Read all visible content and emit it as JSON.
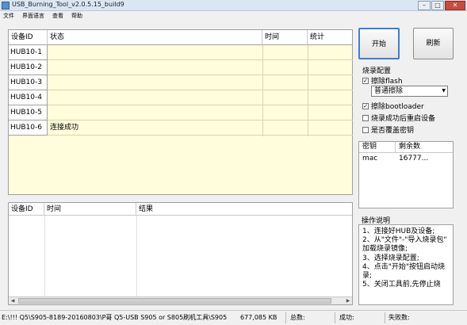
{
  "window": {
    "title": "USB_Burning_Tool_v2.0.5.15_build9",
    "buttons": [
      "–",
      "□",
      "✕"
    ]
  },
  "menu": [
    "文件",
    "界面语言",
    "查看",
    "帮助"
  ],
  "device_grid": {
    "headers": [
      "设备ID",
      "状态",
      "时间",
      "统计"
    ],
    "rows": [
      {
        "id": "HUB10-1",
        "status": ""
      },
      {
        "id": "HUB10-2",
        "status": ""
      },
      {
        "id": "HUB10-3",
        "status": ""
      },
      {
        "id": "HUB10-4",
        "status": ""
      },
      {
        "id": "HUB10-5",
        "status": ""
      },
      {
        "id": "HUB10-6",
        "status": "连接成功"
      }
    ]
  },
  "log_grid": {
    "headers": [
      "设备ID",
      "时间",
      "结果"
    ]
  },
  "buttons": {
    "start": "开始",
    "refresh": "刷新"
  },
  "config": {
    "title": "烧录配置",
    "erase_flash": {
      "label": "擦除flash",
      "checked": true
    },
    "erase_mode": "普通擦除",
    "erase_bootloader": {
      "label": "擦除bootloader",
      "checked": true
    },
    "reboot_after": {
      "label": "烧录成功后重启设备",
      "checked": false
    },
    "overwrite_key": {
      "label": "是否覆盖密钥",
      "checked": false
    }
  },
  "keys": {
    "headers": [
      "密钥",
      "剩余数"
    ],
    "rows": [
      {
        "name": "mac",
        "remaining": "16777..."
      }
    ]
  },
  "help": {
    "title": "操作说明",
    "lines": [
      "1、连接好HUB及设备;",
      "2、从\"文件\"-\"导入烧录包\"",
      "加载烧录镜像;",
      "3、选择烧录配置;",
      "4、点击\"开始\"按钮启动烧",
      "录;",
      "5、关闭工具前,先停止烧"
    ]
  },
  "statusbar": {
    "path": "E:\\!!! Q5\\S905-8189-20160803\\P哥 Q5-USB S905 or S805刷机工具\\S905",
    "size": "677,085 KB",
    "total_label": "总数:",
    "success_label": "成功:",
    "fail_label": "失败数:"
  }
}
